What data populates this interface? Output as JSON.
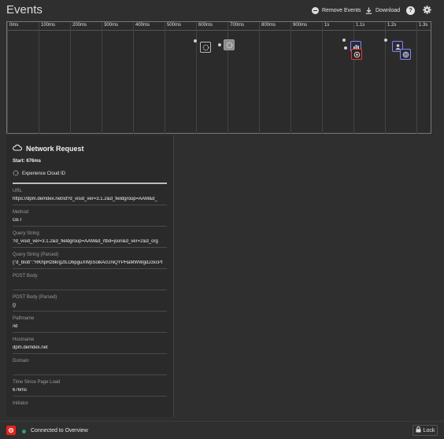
{
  "header": {
    "title": "Events",
    "remove_events_label": "Remove Events",
    "download_label": "Download",
    "help_icon_glyph": "?"
  },
  "timeline": {
    "ticks": [
      "0ms",
      "100ms",
      "200ms",
      "300ms",
      "400ms",
      "500ms",
      "600ms",
      "700ms",
      "800ms",
      "900ms",
      "1s",
      "1.1s",
      "1.2s",
      "1.3s"
    ]
  },
  "panel": {
    "title": "Network Request",
    "start": "Start: 676ms",
    "solution": "Experience Cloud ID",
    "fields": [
      {
        "label": "URL",
        "value": "https://dpm.demdex.net/id?d_visid_ver=3.1.2&d_fieldgroup=AAM&d_"
      },
      {
        "label": "Method",
        "value": "GET"
      },
      {
        "label": "Query String",
        "value": "?d_visid_ver=3.1.2&d_fieldgroup=AAM&d_rtbd=json&d_ver=2&d_org"
      },
      {
        "label": "Query String (Parsed)",
        "value": "{\"d_blob\":\"RKhpRz8krg2tLO6pguXWpSolkAcUniQYPHaMWWgdJ3xcPt"
      },
      {
        "label": "POST Body",
        "value": ""
      },
      {
        "label": "POST Body (Parsed)",
        "value": "{}"
      },
      {
        "label": "Pathname",
        "value": "/id"
      },
      {
        "label": "Hostname",
        "value": "dpm.demdex.net"
      },
      {
        "label": "Domain",
        "value": ""
      },
      {
        "label": "Time Since Page Load",
        "value": "676ms"
      },
      {
        "label": "Initiator",
        "value": ""
      }
    ]
  },
  "footer": {
    "status": "Connected to Overview",
    "lock_label": "Lock"
  },
  "colors": {
    "status_green": "#2d9d78",
    "brand_red": "#e1251b",
    "event_blue": "#7f86f0",
    "event_red": "#e23a3a"
  }
}
